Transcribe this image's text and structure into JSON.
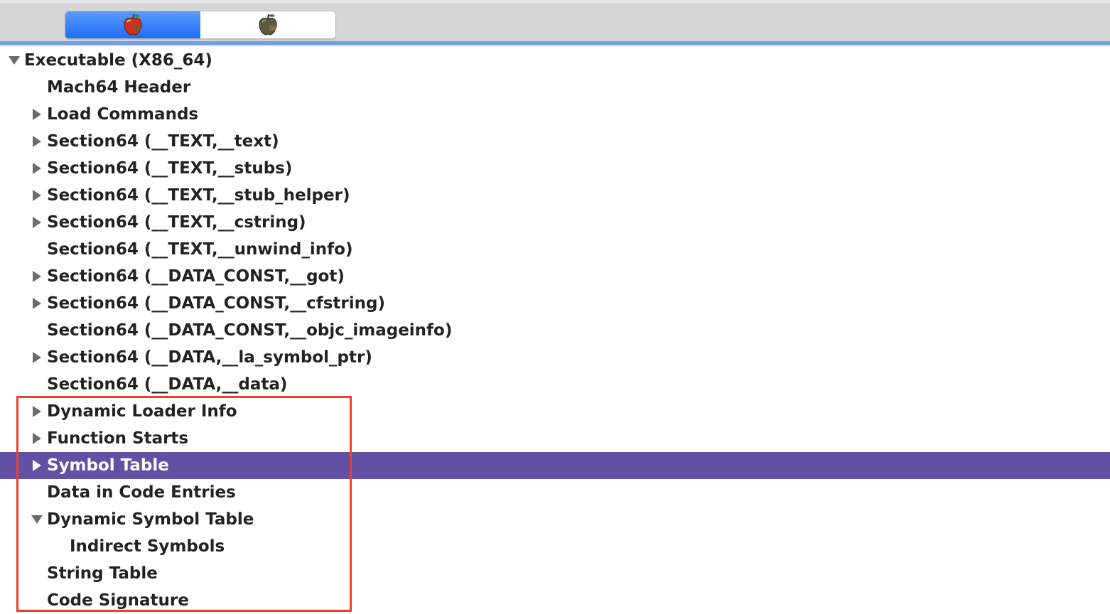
{
  "toolbar": {
    "segments": [
      {
        "icon": "red-apple-icon",
        "active": true
      },
      {
        "icon": "dark-apple-icon",
        "active": false
      }
    ]
  },
  "colors": {
    "selection": "#6150a4",
    "highlight_box": "#e8412f",
    "segment_active": "#1e6df5"
  },
  "tree": {
    "rows": [
      {
        "label": "Executable  (X86_64)",
        "disclosure": "expanded"
      },
      {
        "label": "Mach64 Header",
        "disclosure": "none"
      },
      {
        "label": "Load Commands",
        "disclosure": "collapsed"
      },
      {
        "label": "Section64 (__TEXT,__text)",
        "disclosure": "collapsed"
      },
      {
        "label": "Section64 (__TEXT,__stubs)",
        "disclosure": "collapsed"
      },
      {
        "label": "Section64 (__TEXT,__stub_helper)",
        "disclosure": "collapsed"
      },
      {
        "label": "Section64 (__TEXT,__cstring)",
        "disclosure": "collapsed"
      },
      {
        "label": "Section64 (__TEXT,__unwind_info)",
        "disclosure": "none"
      },
      {
        "label": "Section64 (__DATA_CONST,__got)",
        "disclosure": "collapsed"
      },
      {
        "label": "Section64 (__DATA_CONST,__cfstring)",
        "disclosure": "collapsed"
      },
      {
        "label": "Section64 (__DATA_CONST,__objc_imageinfo)",
        "disclosure": "none"
      },
      {
        "label": "Section64 (__DATA,__la_symbol_ptr)",
        "disclosure": "collapsed"
      },
      {
        "label": "Section64 (__DATA,__data)",
        "disclosure": "none"
      },
      {
        "label": "Dynamic Loader Info",
        "disclosure": "collapsed"
      },
      {
        "label": "Function Starts",
        "disclosure": "collapsed"
      },
      {
        "label": "Symbol Table",
        "disclosure": "collapsed",
        "selected": true
      },
      {
        "label": "Data in Code Entries",
        "disclosure": "none"
      },
      {
        "label": "Dynamic Symbol Table",
        "disclosure": "expanded"
      },
      {
        "label": "Indirect Symbols",
        "disclosure": "none"
      },
      {
        "label": "String Table",
        "disclosure": "none"
      },
      {
        "label": "Code Signature",
        "disclosure": "none"
      }
    ]
  }
}
